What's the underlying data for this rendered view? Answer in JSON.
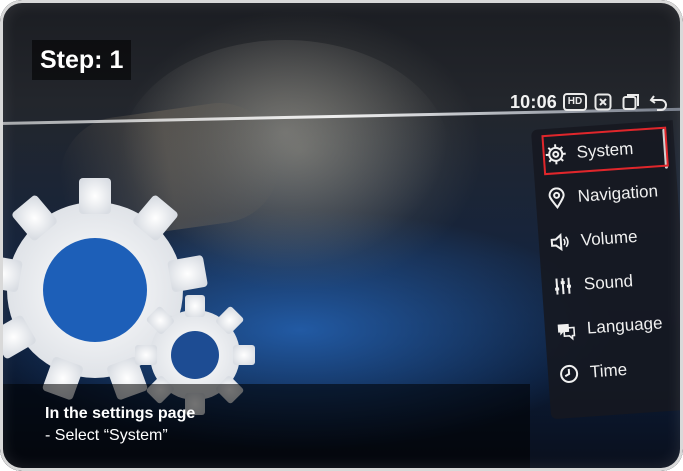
{
  "step": {
    "label": "Step: 1"
  },
  "status_bar": {
    "time": "10:06",
    "hd_label": "HD"
  },
  "menu": {
    "items": [
      {
        "label": "System",
        "icon": "gear-icon",
        "selected": true
      },
      {
        "label": "Navigation",
        "icon": "location-pin-icon",
        "selected": false
      },
      {
        "label": "Volume",
        "icon": "speaker-icon",
        "selected": false
      },
      {
        "label": "Sound",
        "icon": "equalizer-icon",
        "selected": false
      },
      {
        "label": "Language",
        "icon": "language-icon",
        "selected": false
      },
      {
        "label": "Time",
        "icon": "clock-icon",
        "selected": false
      }
    ]
  },
  "caption": {
    "title": "In the settings page",
    "subtitle": "- Select “System”"
  },
  "colors": {
    "highlight": "#e0262b",
    "screen_blue": "#15243d",
    "menu_bg": "#16181f"
  }
}
